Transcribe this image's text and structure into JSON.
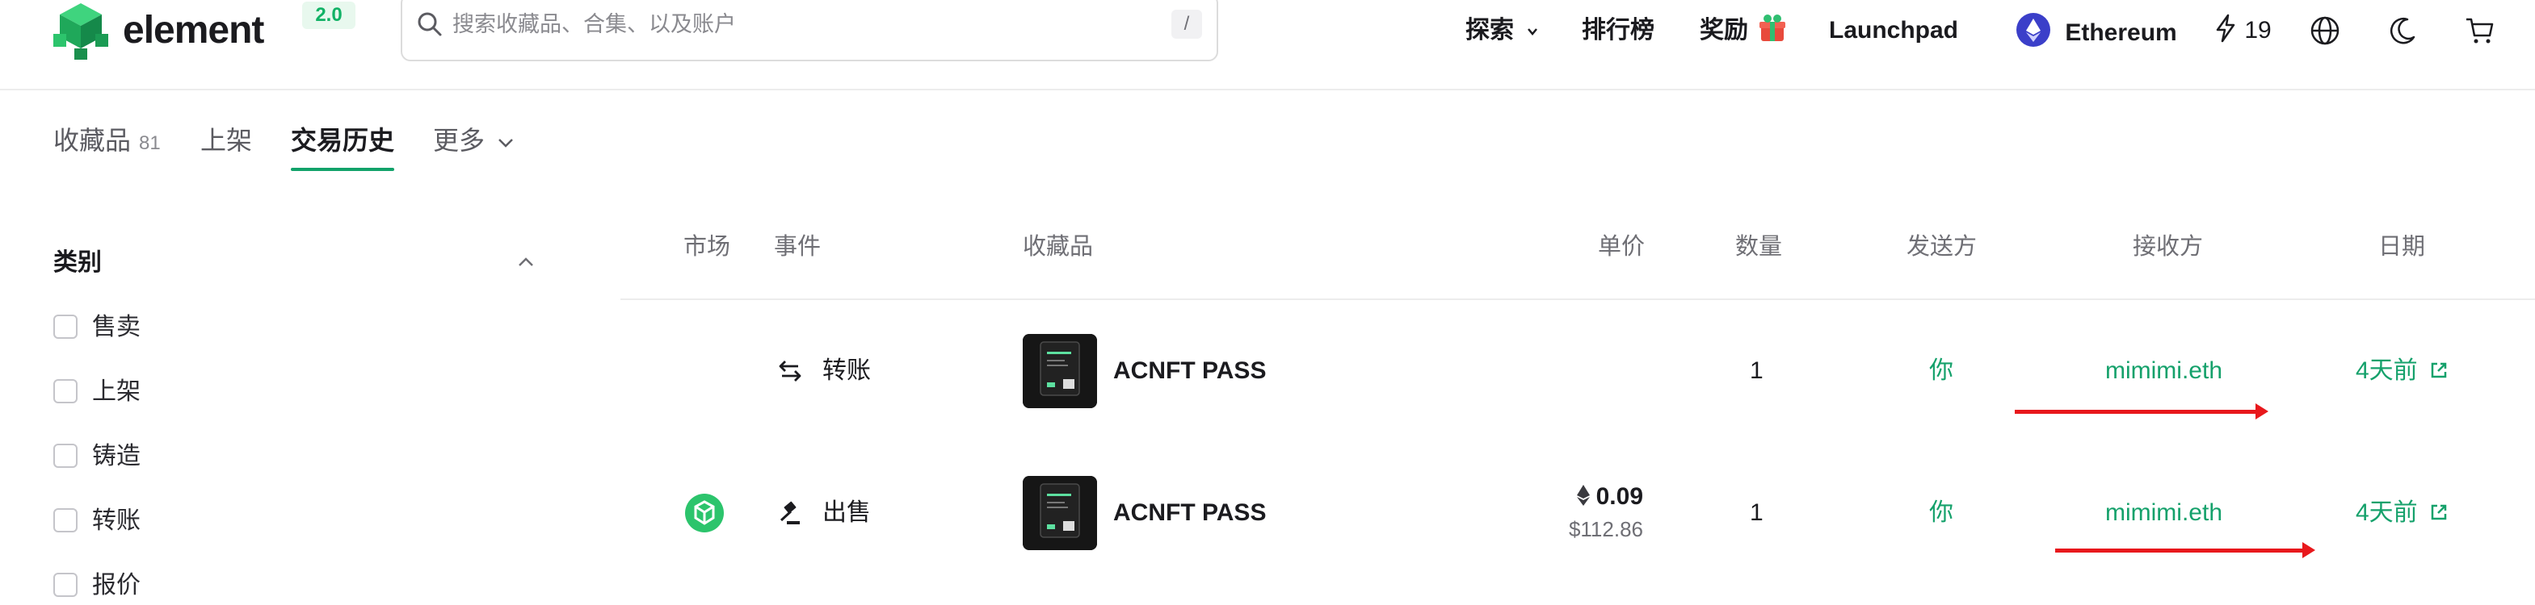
{
  "header": {
    "brand": "element",
    "version": "2.0",
    "search_placeholder": "搜索收藏品、合集、以及账户",
    "search_shortcut": "/",
    "nav": {
      "explore": "探索",
      "rankings": "排行榜",
      "rewards": "奖励",
      "launchpad": "Launchpad",
      "network": "Ethereum",
      "energy": "19"
    }
  },
  "tabs": {
    "collectibles": "收藏品",
    "collectibles_count": "81",
    "listed": "上架",
    "history": "交易历史",
    "more": "更多"
  },
  "sidebar": {
    "title": "类别",
    "filters": [
      "售卖",
      "上架",
      "铸造",
      "转账",
      "报价"
    ]
  },
  "table": {
    "headers": {
      "market": "市场",
      "event": "事件",
      "item": "收藏品",
      "price": "单价",
      "quantity": "数量",
      "from": "发送方",
      "to": "接收方",
      "date": "日期"
    },
    "rows": [
      {
        "event": "转账",
        "item": "ACNFT PASS",
        "price": "",
        "price_usd": "",
        "quantity": "1",
        "from": "你",
        "to": "mimimi.eth",
        "date": "4天前"
      },
      {
        "event": "出售",
        "item": "ACNFT PASS",
        "price": "0.09",
        "price_usd": "$112.86",
        "quantity": "1",
        "from": "你",
        "to": "mimimi.eth",
        "date": "4天前"
      }
    ]
  },
  "colors": {
    "accent_green": "#15a16b",
    "annotation_red": "#e8181c",
    "ethereum_purple": "#3b3fc9"
  }
}
